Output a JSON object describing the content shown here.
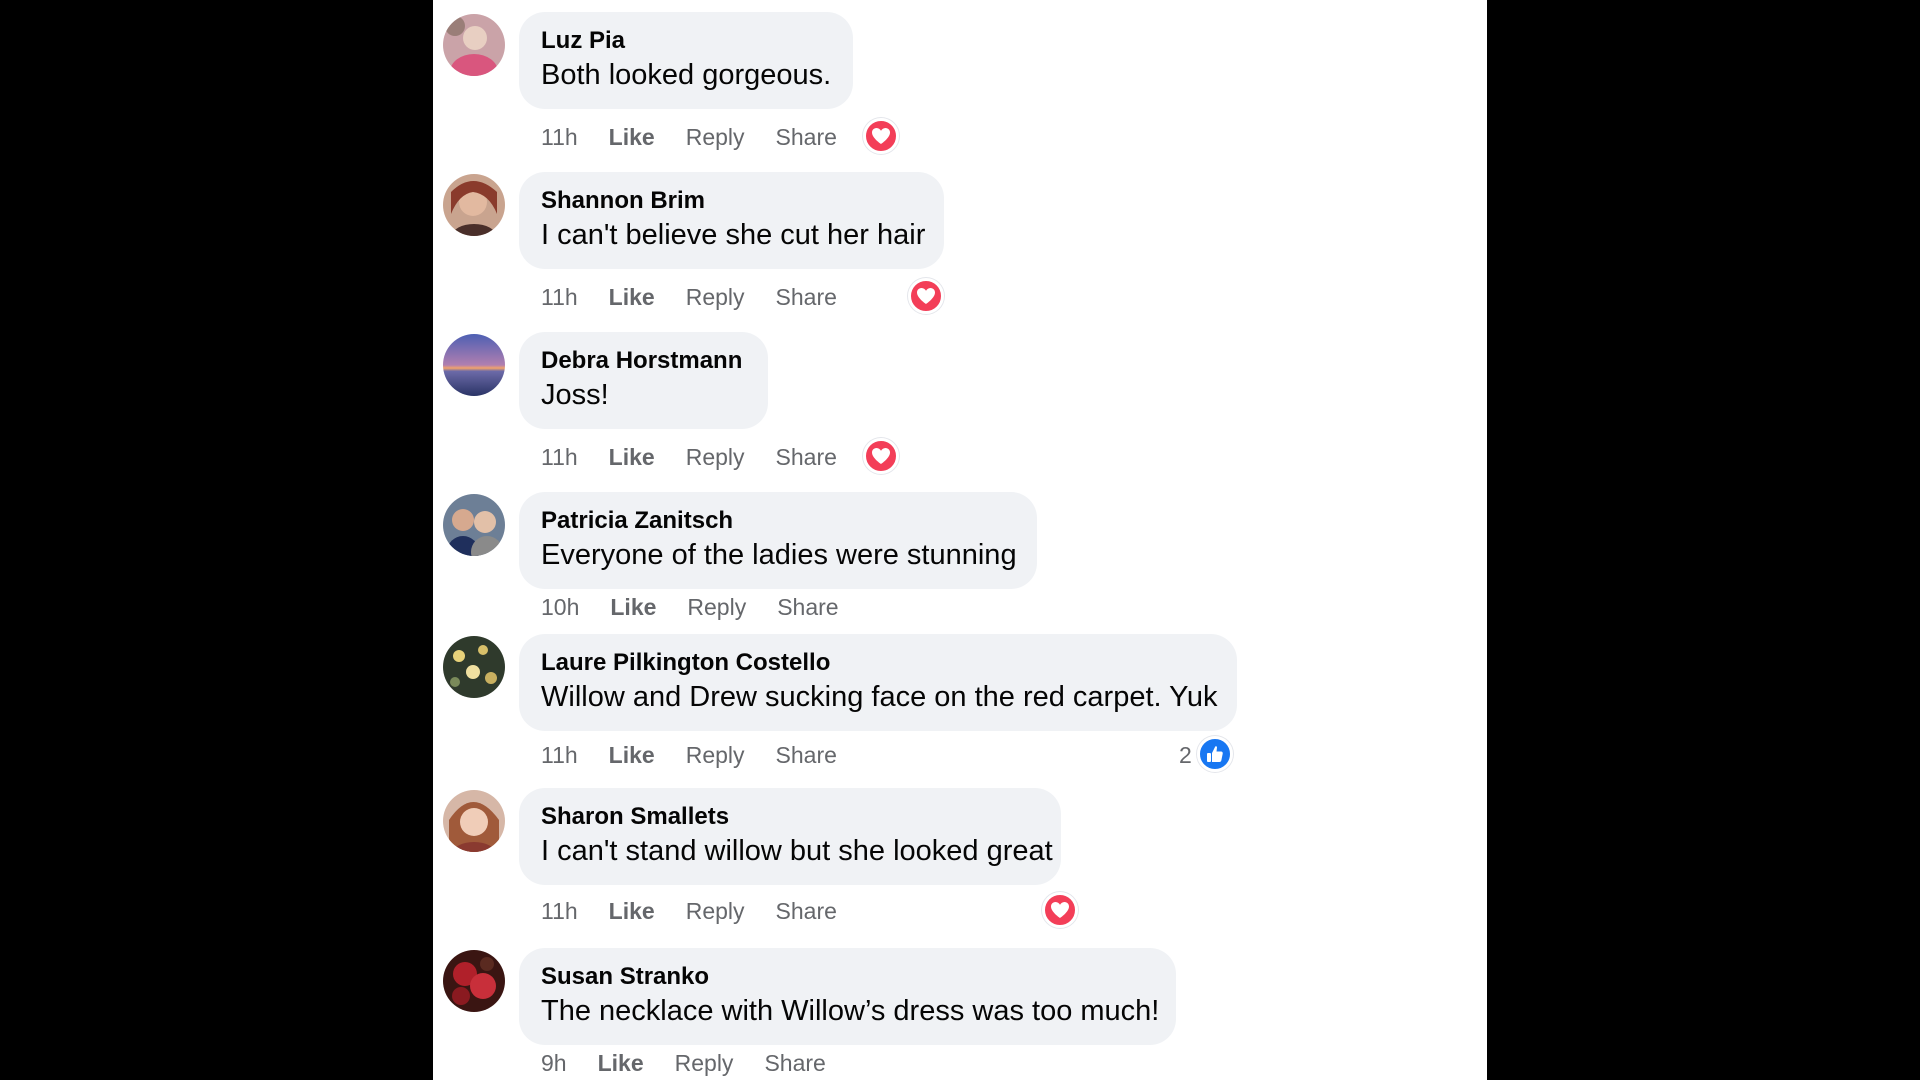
{
  "colors": {
    "background": "#000000",
    "panel": "#ffffff",
    "bubble": "#f0f2f5",
    "name_text": "#050505",
    "meta_text": "#65676b",
    "heart": "#f33e58",
    "like": "#1877f2"
  },
  "actions": {
    "like": "Like",
    "reply": "Reply",
    "share": "Share"
  },
  "comments": [
    {
      "name": "Luz Pia",
      "text": "Both looked gorgeous.",
      "time": "11h",
      "reaction": "heart-icon"
    },
    {
      "name": "Shannon Brim",
      "text": "I can't believe she cut her hair",
      "time": "11h",
      "reaction": "heart-icon"
    },
    {
      "name": "Debra Horstmann",
      "text": "Joss!",
      "time": "11h",
      "reaction": "heart-icon"
    },
    {
      "name": "Patricia Zanitsch",
      "text": "Everyone of the ladies were stunning",
      "time": "10h",
      "reaction": ""
    },
    {
      "name": "Laure Pilkington Costello",
      "text": "Willow and Drew sucking face on the red carpet. Yuk",
      "time": "11h",
      "reaction": "thumbs-up-icon",
      "reaction_count": "2"
    },
    {
      "name": "Sharon Smallets",
      "text": "I can't stand willow but she looked great",
      "time": "11h",
      "reaction": "heart-icon"
    },
    {
      "name": "Susan Stranko",
      "text": "The necklace with Willow’s dress was too much!",
      "time": "9h",
      "reaction": ""
    }
  ]
}
